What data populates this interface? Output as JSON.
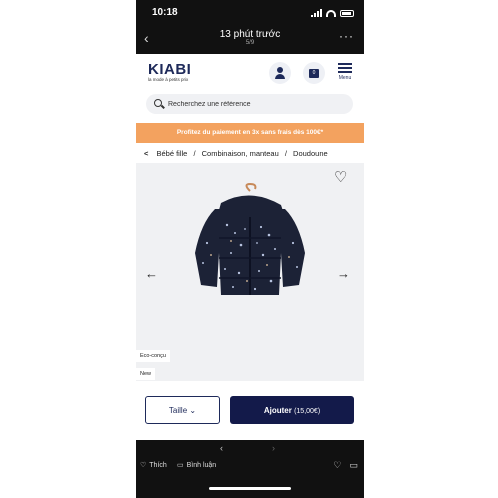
{
  "status_bar": {
    "time": "10:18"
  },
  "top_bar": {
    "title": "13 phút trước",
    "counter": "5/9"
  },
  "site": {
    "logo_name": "KIABI",
    "logo_tagline": "la mode à petits prix",
    "menu_label": "Menu",
    "cart_count": "0"
  },
  "search": {
    "placeholder": "Recherchez une référence"
  },
  "promo": {
    "text": "Profitez du paiement en 3x sans frais dès 100€*"
  },
  "breadcrumb": [
    "Bébé fille",
    "Combinaison, manteau",
    "Doudoune"
  ],
  "product": {
    "badges": [
      "Eco-conçu",
      "New"
    ],
    "size_button": "Taille",
    "add_button": "Ajouter",
    "price": "(15,00€)"
  },
  "bottom_bar": {
    "like_label": "Thích",
    "comment_label": "Bình luận"
  },
  "colors": {
    "brand_navy": "#131a4a",
    "promo_orange": "#f3a25f",
    "jacket": "#1c2236"
  }
}
